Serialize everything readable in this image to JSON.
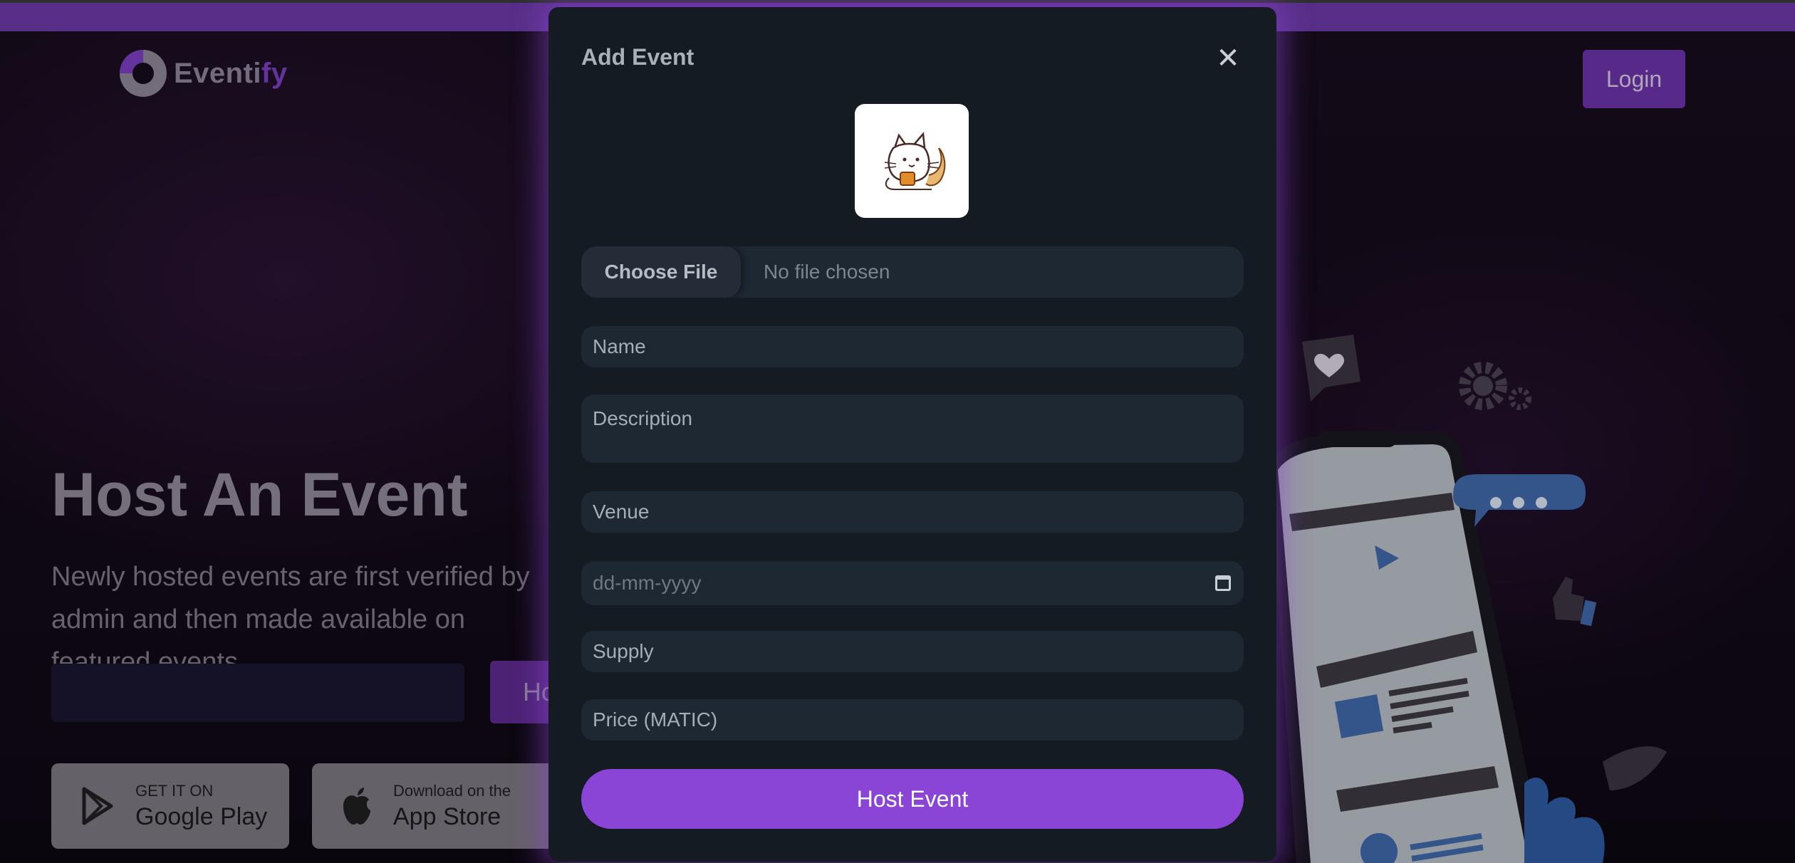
{
  "header": {
    "logo_text_main": "Eventi",
    "logo_text_accent": "fy",
    "login_label": "Login"
  },
  "hero": {
    "title": "Host An Event",
    "subtitle": "Newly hosted events are first verified by admin and then made available on featured events.",
    "button_label": "Host Event"
  },
  "stores": {
    "google": {
      "small": "GET IT ON",
      "big": "Google Play"
    },
    "apple": {
      "small": "Download on the",
      "big": "App Store"
    }
  },
  "modal": {
    "title": "Add Event",
    "close_symbol": "✕",
    "choose_file_label": "Choose File",
    "file_status": "No file chosen",
    "name_placeholder": "Name",
    "description_placeholder": "Description",
    "venue_placeholder": "Venue",
    "date_placeholder": "dd-mm-yyyy",
    "supply_placeholder": "Supply",
    "price_placeholder": "Price (MATIC)",
    "submit_label": "Host Event"
  },
  "colors": {
    "accent": "#8a45d6",
    "modal_bg": "#151b22",
    "field_bg": "#1e2833"
  },
  "icons": [
    "eventify-logo",
    "google-play-icon",
    "apple-icon",
    "close-icon",
    "calendar-icon",
    "cat-illustration",
    "heart-icon",
    "gear-icon",
    "chat-bubble-icon",
    "thumbs-up-icon"
  ]
}
